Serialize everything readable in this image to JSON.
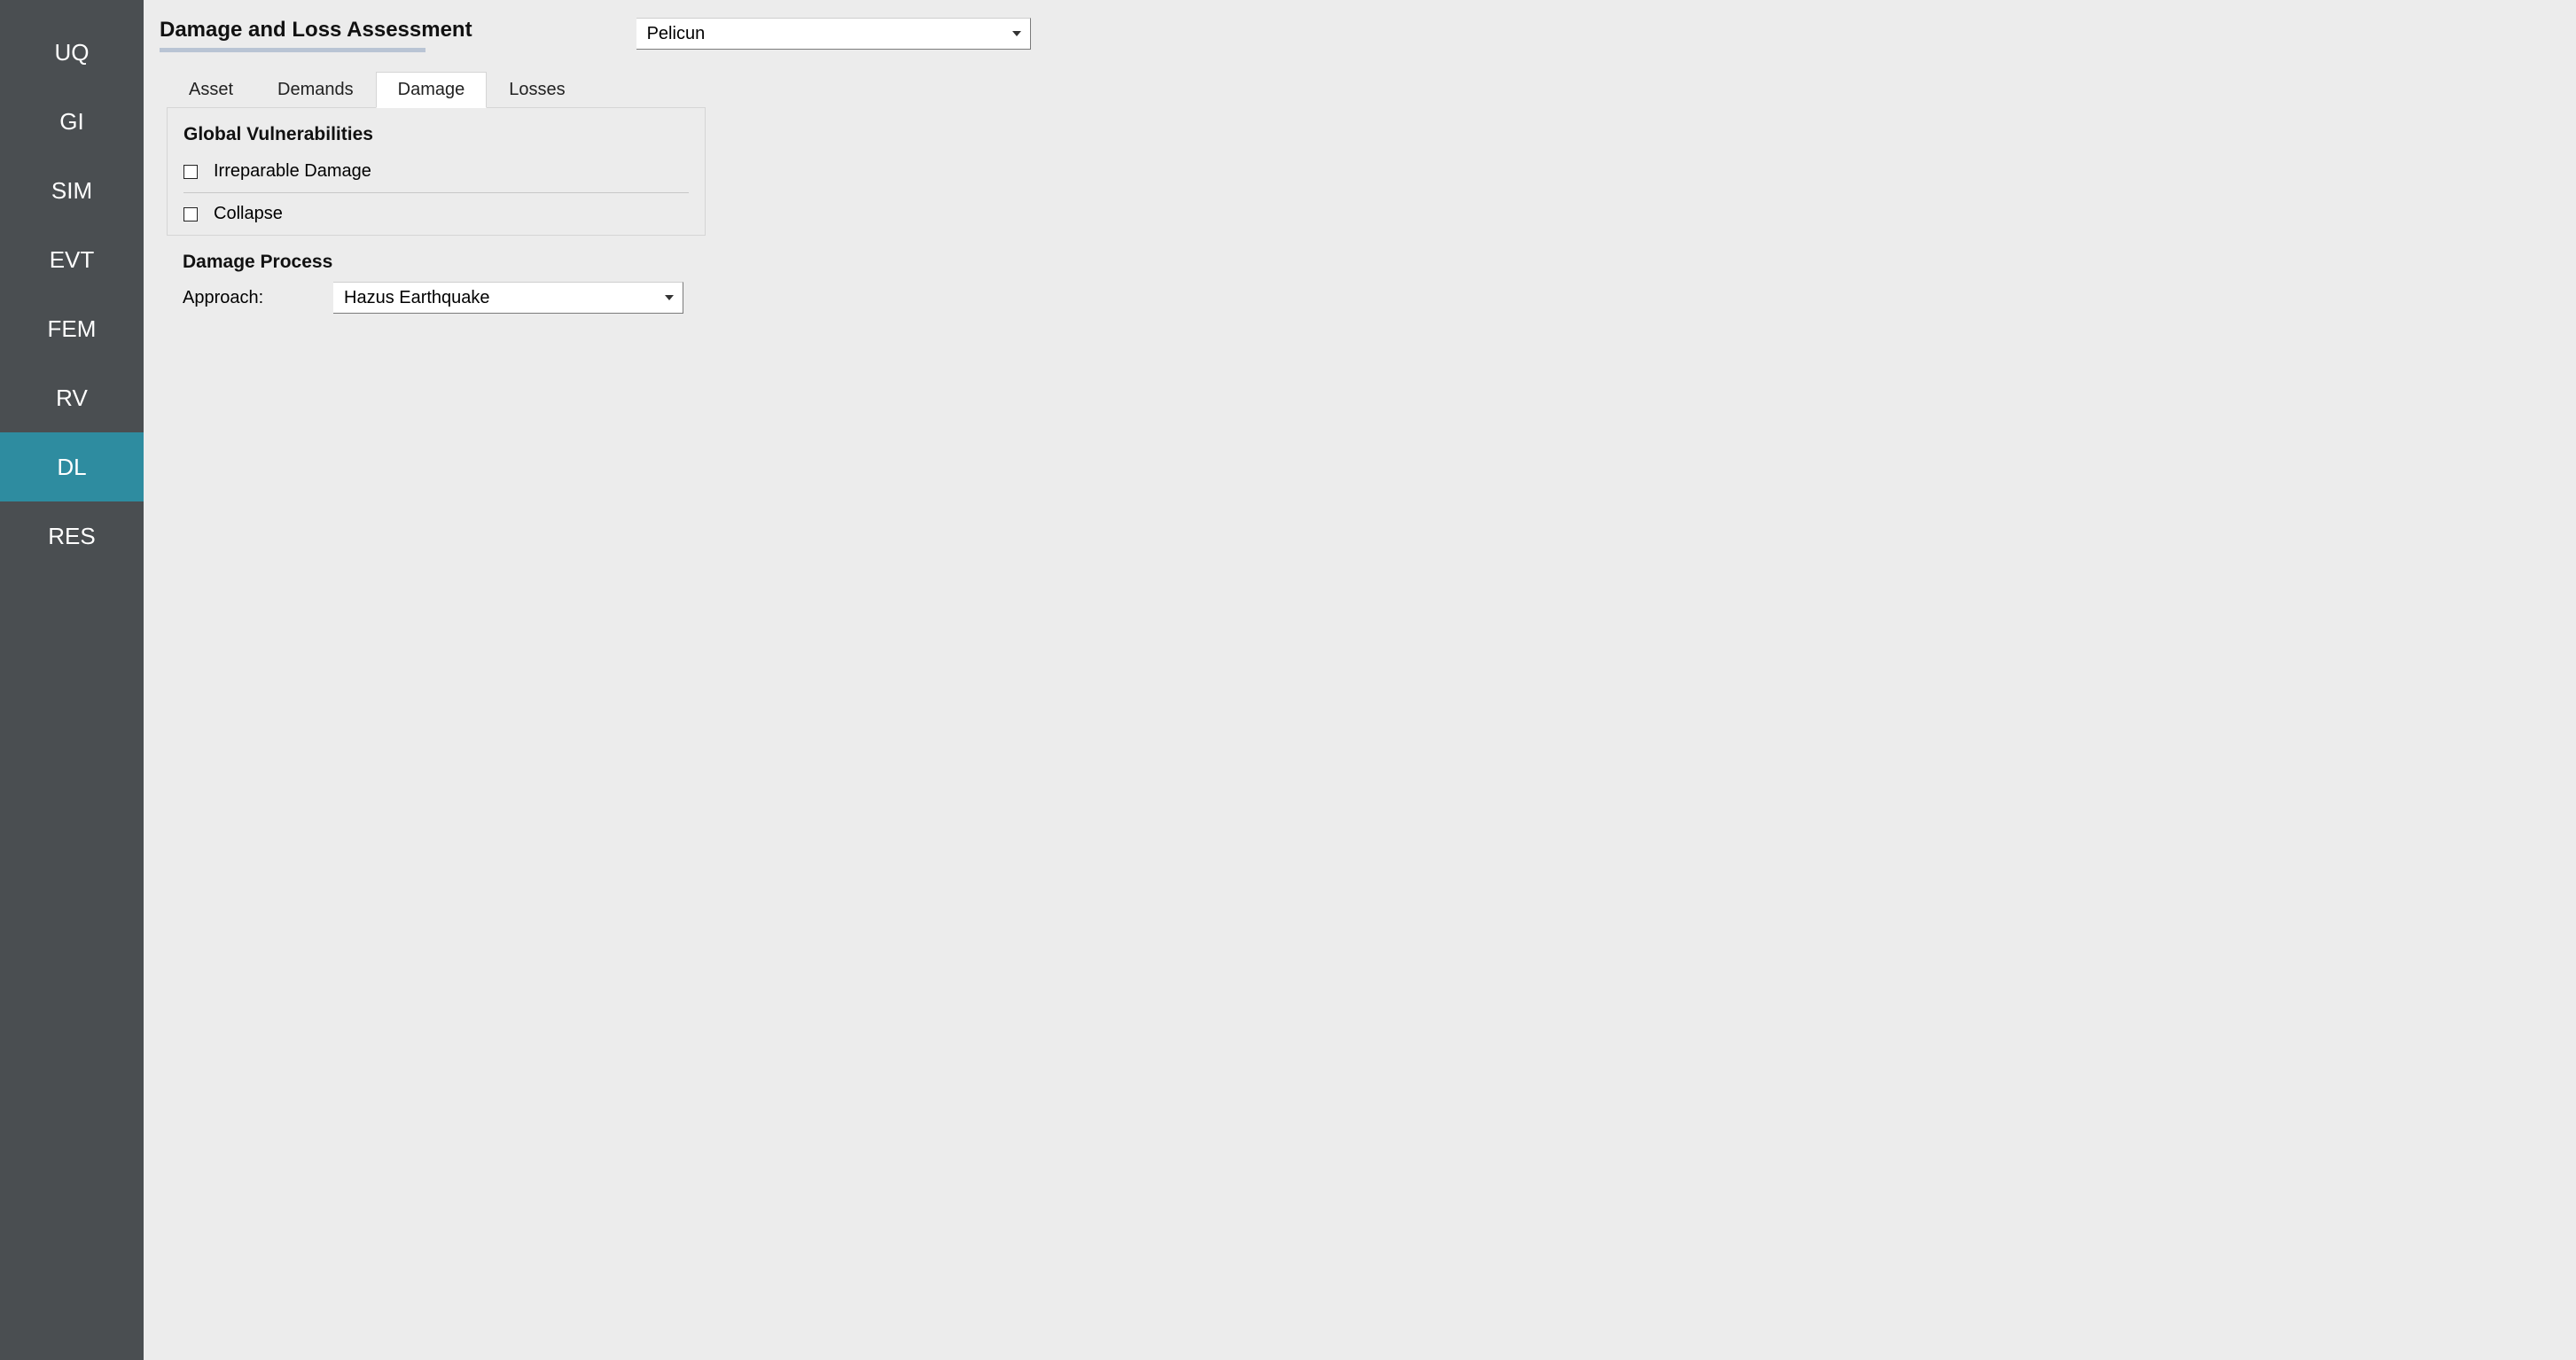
{
  "sidebar": {
    "items": [
      {
        "label": "UQ",
        "active": false
      },
      {
        "label": "GI",
        "active": false
      },
      {
        "label": "SIM",
        "active": false
      },
      {
        "label": "EVT",
        "active": false
      },
      {
        "label": "FEM",
        "active": false
      },
      {
        "label": "RV",
        "active": false
      },
      {
        "label": "DL",
        "active": true
      },
      {
        "label": "RES",
        "active": false
      }
    ]
  },
  "header": {
    "title": "Damage and Loss Assessment",
    "engine_selected": "Pelicun"
  },
  "tabs": [
    {
      "label": "Asset",
      "active": false
    },
    {
      "label": "Demands",
      "active": false
    },
    {
      "label": "Damage",
      "active": true
    },
    {
      "label": "Losses",
      "active": false
    }
  ],
  "global_vulnerabilities": {
    "title": "Global Vulnerabilities",
    "items": [
      {
        "label": "Irreparable Damage",
        "checked": false
      },
      {
        "label": "Collapse",
        "checked": false
      }
    ]
  },
  "damage_process": {
    "title": "Damage Process",
    "approach_label": "Approach:",
    "approach_selected": "Hazus Earthquake"
  }
}
